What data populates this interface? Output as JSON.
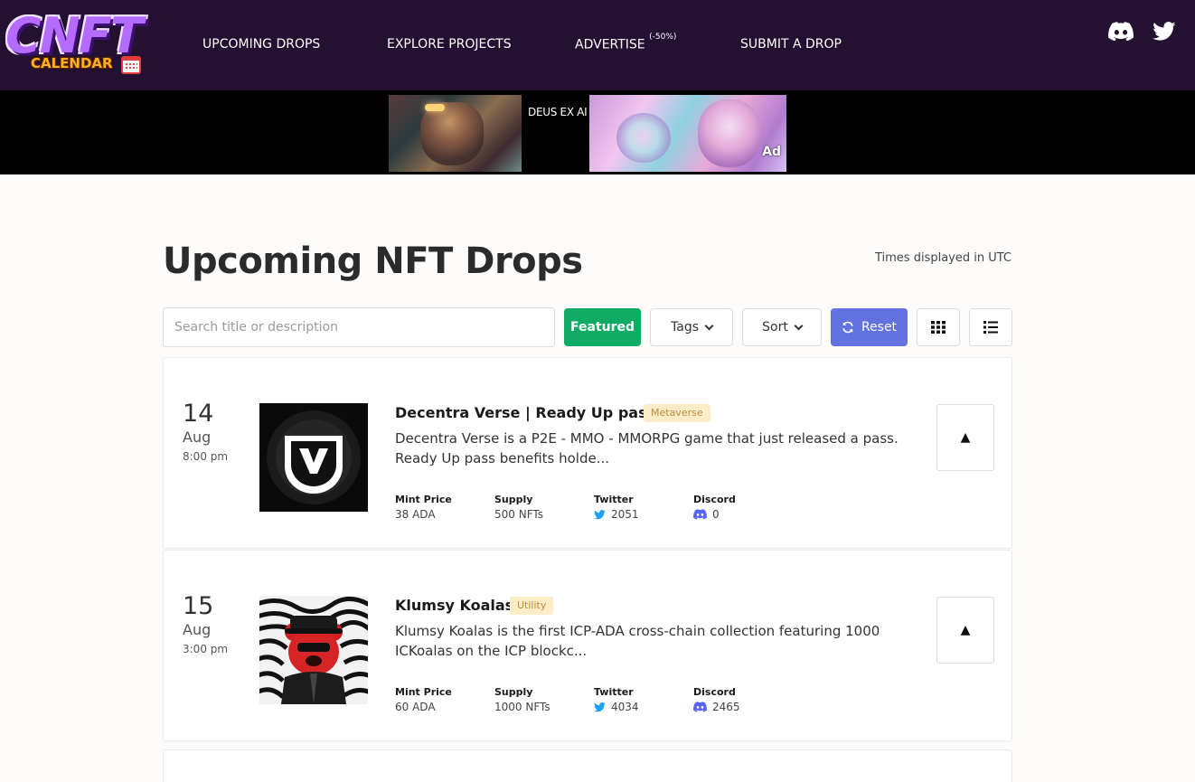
{
  "nav": {
    "logo_main": "CNFT",
    "logo_sub": "CALENDAR",
    "links": [
      {
        "label": "UPCOMING DROPS"
      },
      {
        "label": "EXPLORE PROJECTS"
      },
      {
        "label": "ADVERTISE",
        "sup": "(-50%)"
      },
      {
        "label": "SUBMIT A DROP"
      }
    ],
    "social": [
      "discord-icon",
      "twitter-icon"
    ]
  },
  "ad": {
    "text": "DEUS EX AI",
    "label": "Ad"
  },
  "main": {
    "title": "Upcoming NFT Drops",
    "utc_note": "Times displayed in UTC",
    "search_placeholder": "Search title or description",
    "buttons": {
      "featured": "Featured",
      "tags": "Tags",
      "sort": "Sort",
      "reset": "Reset"
    }
  },
  "stat_labels": {
    "mint": "Mint Price",
    "supply": "Supply",
    "twitter": "Twitter",
    "discord": "Discord"
  },
  "drops": [
    {
      "day": "14",
      "month": "Aug",
      "time": "8:00 pm",
      "title": "Decentra Verse | Ready Up pass|",
      "tag": "Metaverse",
      "description": "Decentra Verse is a P2E - MMO - MMORPG game that just released a pass. Ready Up pass benefits holde...",
      "mint_price": "38 ADA",
      "supply": "500 NFTs",
      "twitter": "2051",
      "discord": "0",
      "vote": "▲"
    },
    {
      "day": "15",
      "month": "Aug",
      "time": "3:00 pm",
      "title": "Klumsy Koalas",
      "tag": "Utility",
      "description": "Klumsy Koalas is the first ICP-ADA cross-chain collection featuring 1000 ICKoalas on the ICP blockc...",
      "mint_price": "60 ADA",
      "supply": "1000 NFTs",
      "twitter": "4034",
      "discord": "2465",
      "vote": "▲"
    }
  ],
  "colors": {
    "nav_bg": "#241131",
    "featured": "#0faa63",
    "reset": "#6272e0",
    "twitter": "#1da1f2",
    "discord": "#5865f2",
    "tag_bg": "#fdecc8"
  }
}
